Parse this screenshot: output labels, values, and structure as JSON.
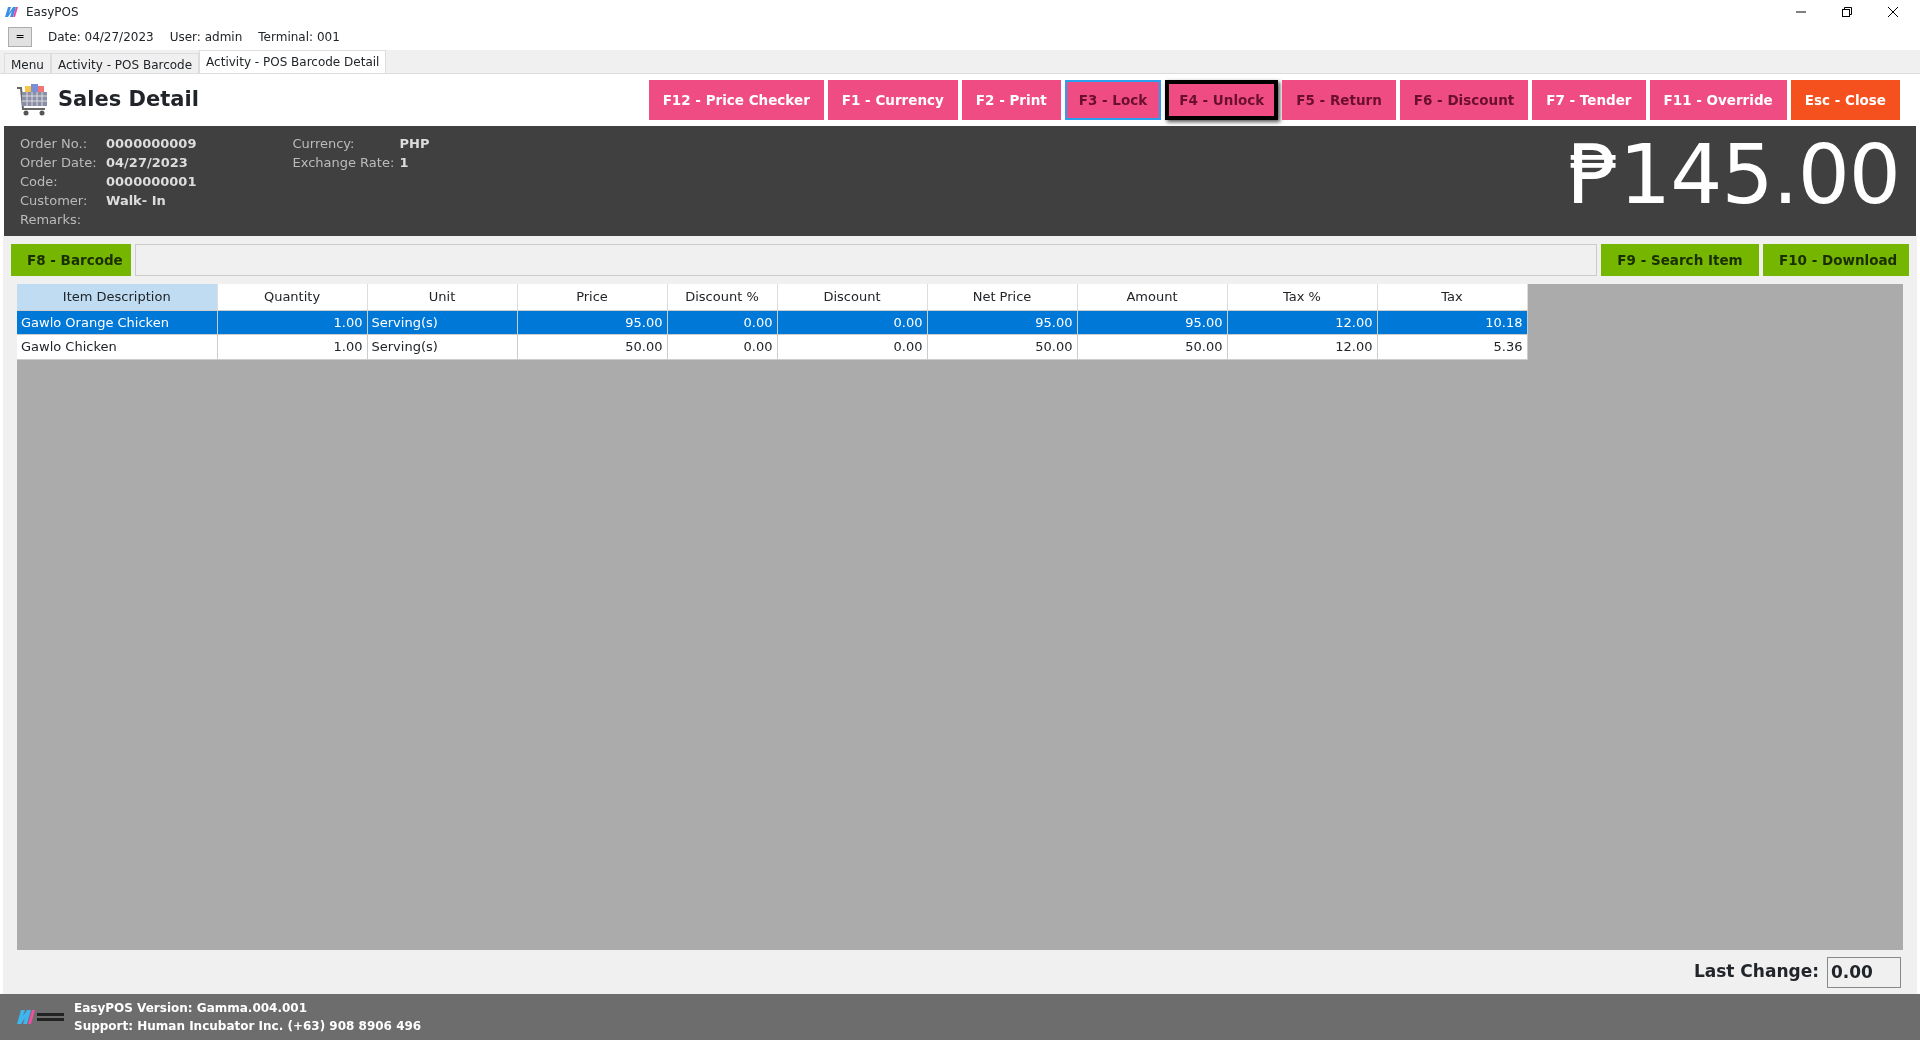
{
  "window": {
    "title": "EasyPOS"
  },
  "toolbar": {
    "menu_button": "=",
    "date": "Date: 04/27/2023",
    "user": "User: admin",
    "terminal": "Terminal: 001"
  },
  "tabs": [
    {
      "label": "Menu",
      "selected": false
    },
    {
      "label": "Activity - POS Barcode",
      "selected": false
    },
    {
      "label": "Activity - POS Barcode Detail",
      "selected": true
    }
  ],
  "page_title": "Sales Detail",
  "actions": [
    {
      "label": "F12 - Price Checker",
      "kind": "pink",
      "disabled": false,
      "focused": false,
      "default": false
    },
    {
      "label": "F1 - Currency",
      "kind": "pink",
      "disabled": false,
      "focused": false,
      "default": false
    },
    {
      "label": "F2 - Print",
      "kind": "pink",
      "disabled": false,
      "focused": false,
      "default": false
    },
    {
      "label": "F3 - Lock",
      "kind": "pink",
      "disabled": true,
      "focused": true,
      "default": false
    },
    {
      "label": "F4 - Unlock",
      "kind": "pink",
      "disabled": true,
      "focused": false,
      "default": true
    },
    {
      "label": "F5 - Return",
      "kind": "pink",
      "disabled": true,
      "focused": false,
      "default": false
    },
    {
      "label": "F6 - Discount",
      "kind": "pink",
      "disabled": true,
      "focused": false,
      "default": false
    },
    {
      "label": "F7 - Tender",
      "kind": "pink",
      "disabled": false,
      "focused": false,
      "default": false
    },
    {
      "label": "F11 - Override",
      "kind": "pink",
      "disabled": false,
      "focused": false,
      "default": false
    },
    {
      "label": "Esc - Close",
      "kind": "orange",
      "disabled": false,
      "focused": false,
      "default": false
    }
  ],
  "info_left": [
    {
      "label": "Order No.:",
      "value": "0000000009"
    },
    {
      "label": "Order Date:",
      "value": "04/27/2023"
    },
    {
      "label": "Code:",
      "value": "0000000001"
    },
    {
      "label": "Customer:",
      "value": "Walk- In"
    },
    {
      "label": "Remarks:"
    }
  ],
  "info_right": [
    {
      "label": "Currency:",
      "value": "PHP"
    },
    {
      "label": "Exchange Rate:",
      "value": "1"
    }
  ],
  "total": "₱145.00",
  "barcode_button": "F8 - Barcode",
  "search_button": "F9 - Search Item",
  "download_button": "F10 - Download",
  "table": {
    "columns": [
      "Item Description",
      "Quantity",
      "Unit",
      "Price",
      "Discount %",
      "Discount",
      "Net Price",
      "Amount",
      "Tax %",
      "Tax"
    ],
    "rows": [
      {
        "selected": true,
        "cells": [
          "Gawlo Orange Chicken",
          "1.00",
          "Serving(s)",
          "95.00",
          "0.00",
          "0.00",
          "95.00",
          "95.00",
          "12.00",
          "10.18"
        ]
      },
      {
        "selected": false,
        "cells": [
          "Gawlo Chicken",
          "1.00",
          "Serving(s)",
          "50.00",
          "0.00",
          "0.00",
          "50.00",
          "50.00",
          "12.00",
          "5.36"
        ]
      }
    ]
  },
  "last_change": {
    "label": "Last Change:",
    "value": "0.00"
  },
  "status_bar": {
    "version": "EasyPOS Version: Gamma.004.001",
    "support": "Support: Human Incubator Inc. (+63) 908 8906 496"
  }
}
